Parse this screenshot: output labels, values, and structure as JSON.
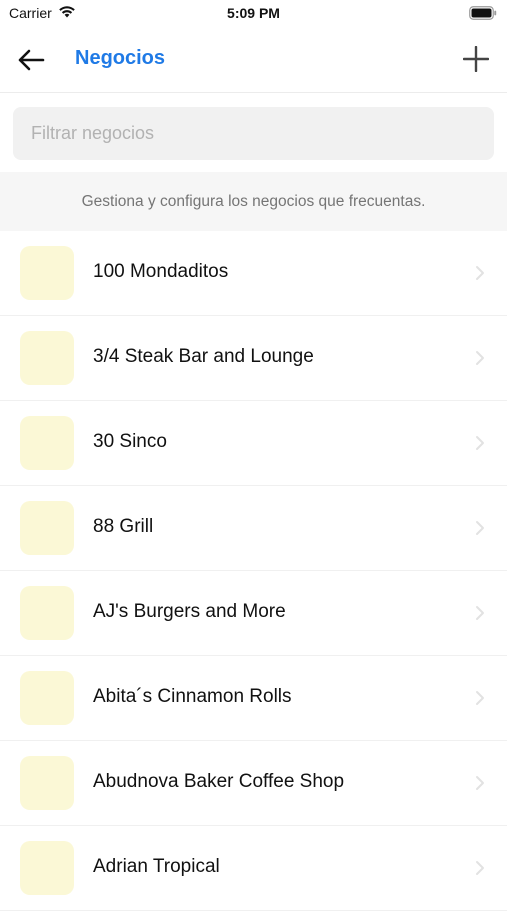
{
  "status_bar": {
    "carrier": "Carrier",
    "time": "5:09 PM"
  },
  "nav": {
    "title": "Negocios",
    "back_icon": "arrow-left-icon",
    "add_icon": "plus-icon",
    "accent_color": "#1f7ae6"
  },
  "search": {
    "placeholder": "Filtrar negocios",
    "value": ""
  },
  "description": "Gestiona y configura los negocios que frecuentas.",
  "businesses": [
    {
      "name": "100 Mondaditos"
    },
    {
      "name": "3/4 Steak Bar and Lounge"
    },
    {
      "name": "30 Sinco"
    },
    {
      "name": "88 Grill"
    },
    {
      "name": "AJ's Burgers and More"
    },
    {
      "name": "Abita´s Cinnamon Rolls"
    },
    {
      "name": "Abudnova Baker Coffee Shop"
    },
    {
      "name": "Adrian Tropical"
    }
  ],
  "colors": {
    "thumbnail": "#fbf8d6",
    "chevron": "#e2e2e2"
  }
}
